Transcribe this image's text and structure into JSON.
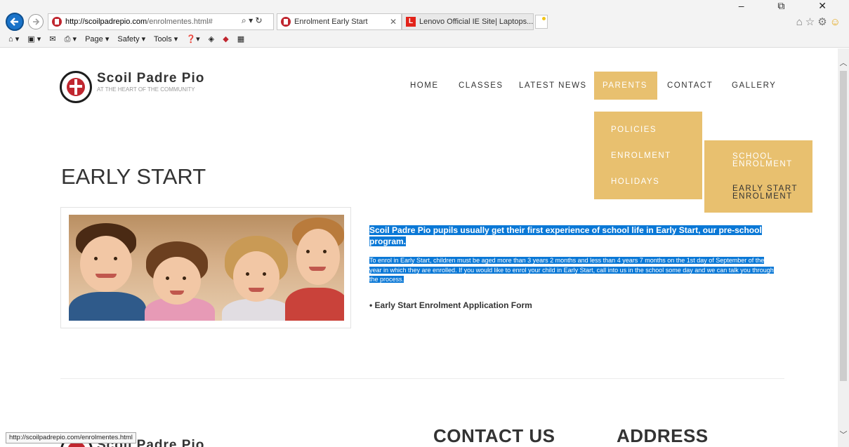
{
  "browser": {
    "url_domain": "http://scoilpadrepio.com",
    "url_path": "/enrolmentes.html#",
    "tabs": [
      {
        "label": "Enrolment Early Start"
      },
      {
        "label": "Lenovo Official IE Site| Laptops..."
      }
    ],
    "window_controls": "–  ⧉  ✕",
    "command_bar": {
      "page": "Page ▾",
      "safety": "Safety ▾",
      "tools": "Tools ▾"
    },
    "status_url": "http://scoilpadrepio.com/enrolmentes.html"
  },
  "site": {
    "name": "Scoil Padre Pio",
    "tagline": "AT THE HEART OF THE COMMUNITY"
  },
  "nav": {
    "home": "HOME",
    "classes": "CLASSES",
    "latest_news": "LATEST NEWS",
    "parents": "PARENTS",
    "contact": "CONTACT",
    "gallery": "GALLERY"
  },
  "parents_menu": {
    "policies": "POLICIES",
    "enrolment": "ENROLMENT",
    "holidays": "HOLIDAYS"
  },
  "enrolment_menu": {
    "school_enrolment": "SCHOOL ENROLMENT",
    "early_start_enrolment": "EARLY START ENROLMENT"
  },
  "main": {
    "title": "EARLY START",
    "intro": "Scoil Padre Pio pupils usually get their first experience of school life in Early Start, our pre-school program.",
    "details": "To enrol in Early Start, children must be aged more than 3 years 2 months and less than 4 years 7 months on the 1st day of September of the year in which they are enrolled. If you would like to enrol your child in Early Start, call into us in the school some day and we can talk you through the process.",
    "form_link": "• Early Start Enrolment Application Form"
  },
  "footer": {
    "name": "Scoil Padre Pio",
    "contact_heading": "CONTACT US",
    "address_heading": "ADDRESS"
  },
  "colors": {
    "accent": "#e8c06f",
    "selection": "#0a78d6",
    "brand_red": "#c0262f"
  }
}
